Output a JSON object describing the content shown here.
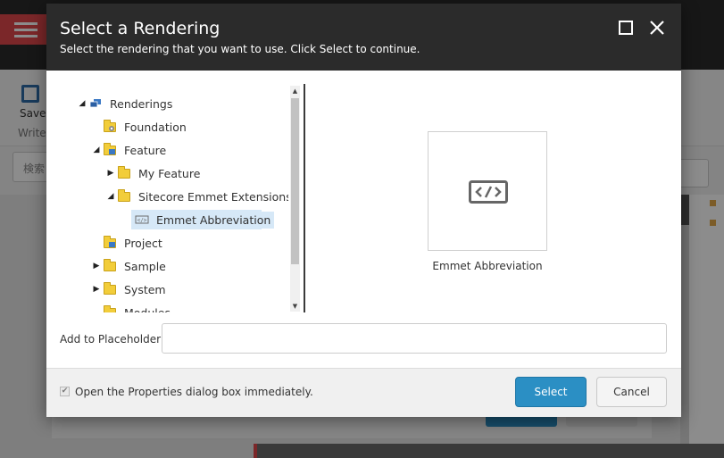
{
  "background": {
    "save_label": "Save",
    "write_label": "Write",
    "search_text": "検索"
  },
  "dialog": {
    "title": "Select a Rendering",
    "subtitle": "Select the rendering that you want to use. Click Select to continue.",
    "tree": [
      {
        "label": "Renderings",
        "icon": "renderings-icon",
        "expanded": true,
        "level": 0
      },
      {
        "label": "Foundation",
        "icon": "folder-gear-icon",
        "level": 1
      },
      {
        "label": "Feature",
        "icon": "folder-feature-icon",
        "expanded": true,
        "level": 1
      },
      {
        "label": "My Feature",
        "icon": "folder-icon",
        "expanded": false,
        "level": 2
      },
      {
        "label": "Sitecore Emmet Extensions",
        "icon": "folder-icon",
        "expanded": true,
        "level": 2
      },
      {
        "label": "Emmet Abbreviation",
        "icon": "rendering-code-icon",
        "selected": true,
        "level": 3
      },
      {
        "label": "Project",
        "icon": "folder-project-icon",
        "level": 1
      },
      {
        "label": "Sample",
        "icon": "folder-icon",
        "expanded": false,
        "level": 1
      },
      {
        "label": "System",
        "icon": "folder-icon",
        "expanded": false,
        "level": 1
      },
      {
        "label": "Modules",
        "icon": "folder-icon",
        "level": 1
      }
    ],
    "preview": {
      "icon": "code-icon",
      "label": "Emmet Abbreviation"
    },
    "placeholder": {
      "label": "Add to Placeholder:",
      "value": ""
    },
    "open_properties": {
      "label": "Open the Properties dialog box immediately.",
      "checked": true
    },
    "buttons": {
      "select": "Select",
      "cancel": "Cancel"
    }
  },
  "colors": {
    "header_bg": "#2b2b2b",
    "primary_button": "#2b8fc4",
    "selected_row": "#d6e8f7",
    "accent_red": "#e0474c"
  }
}
